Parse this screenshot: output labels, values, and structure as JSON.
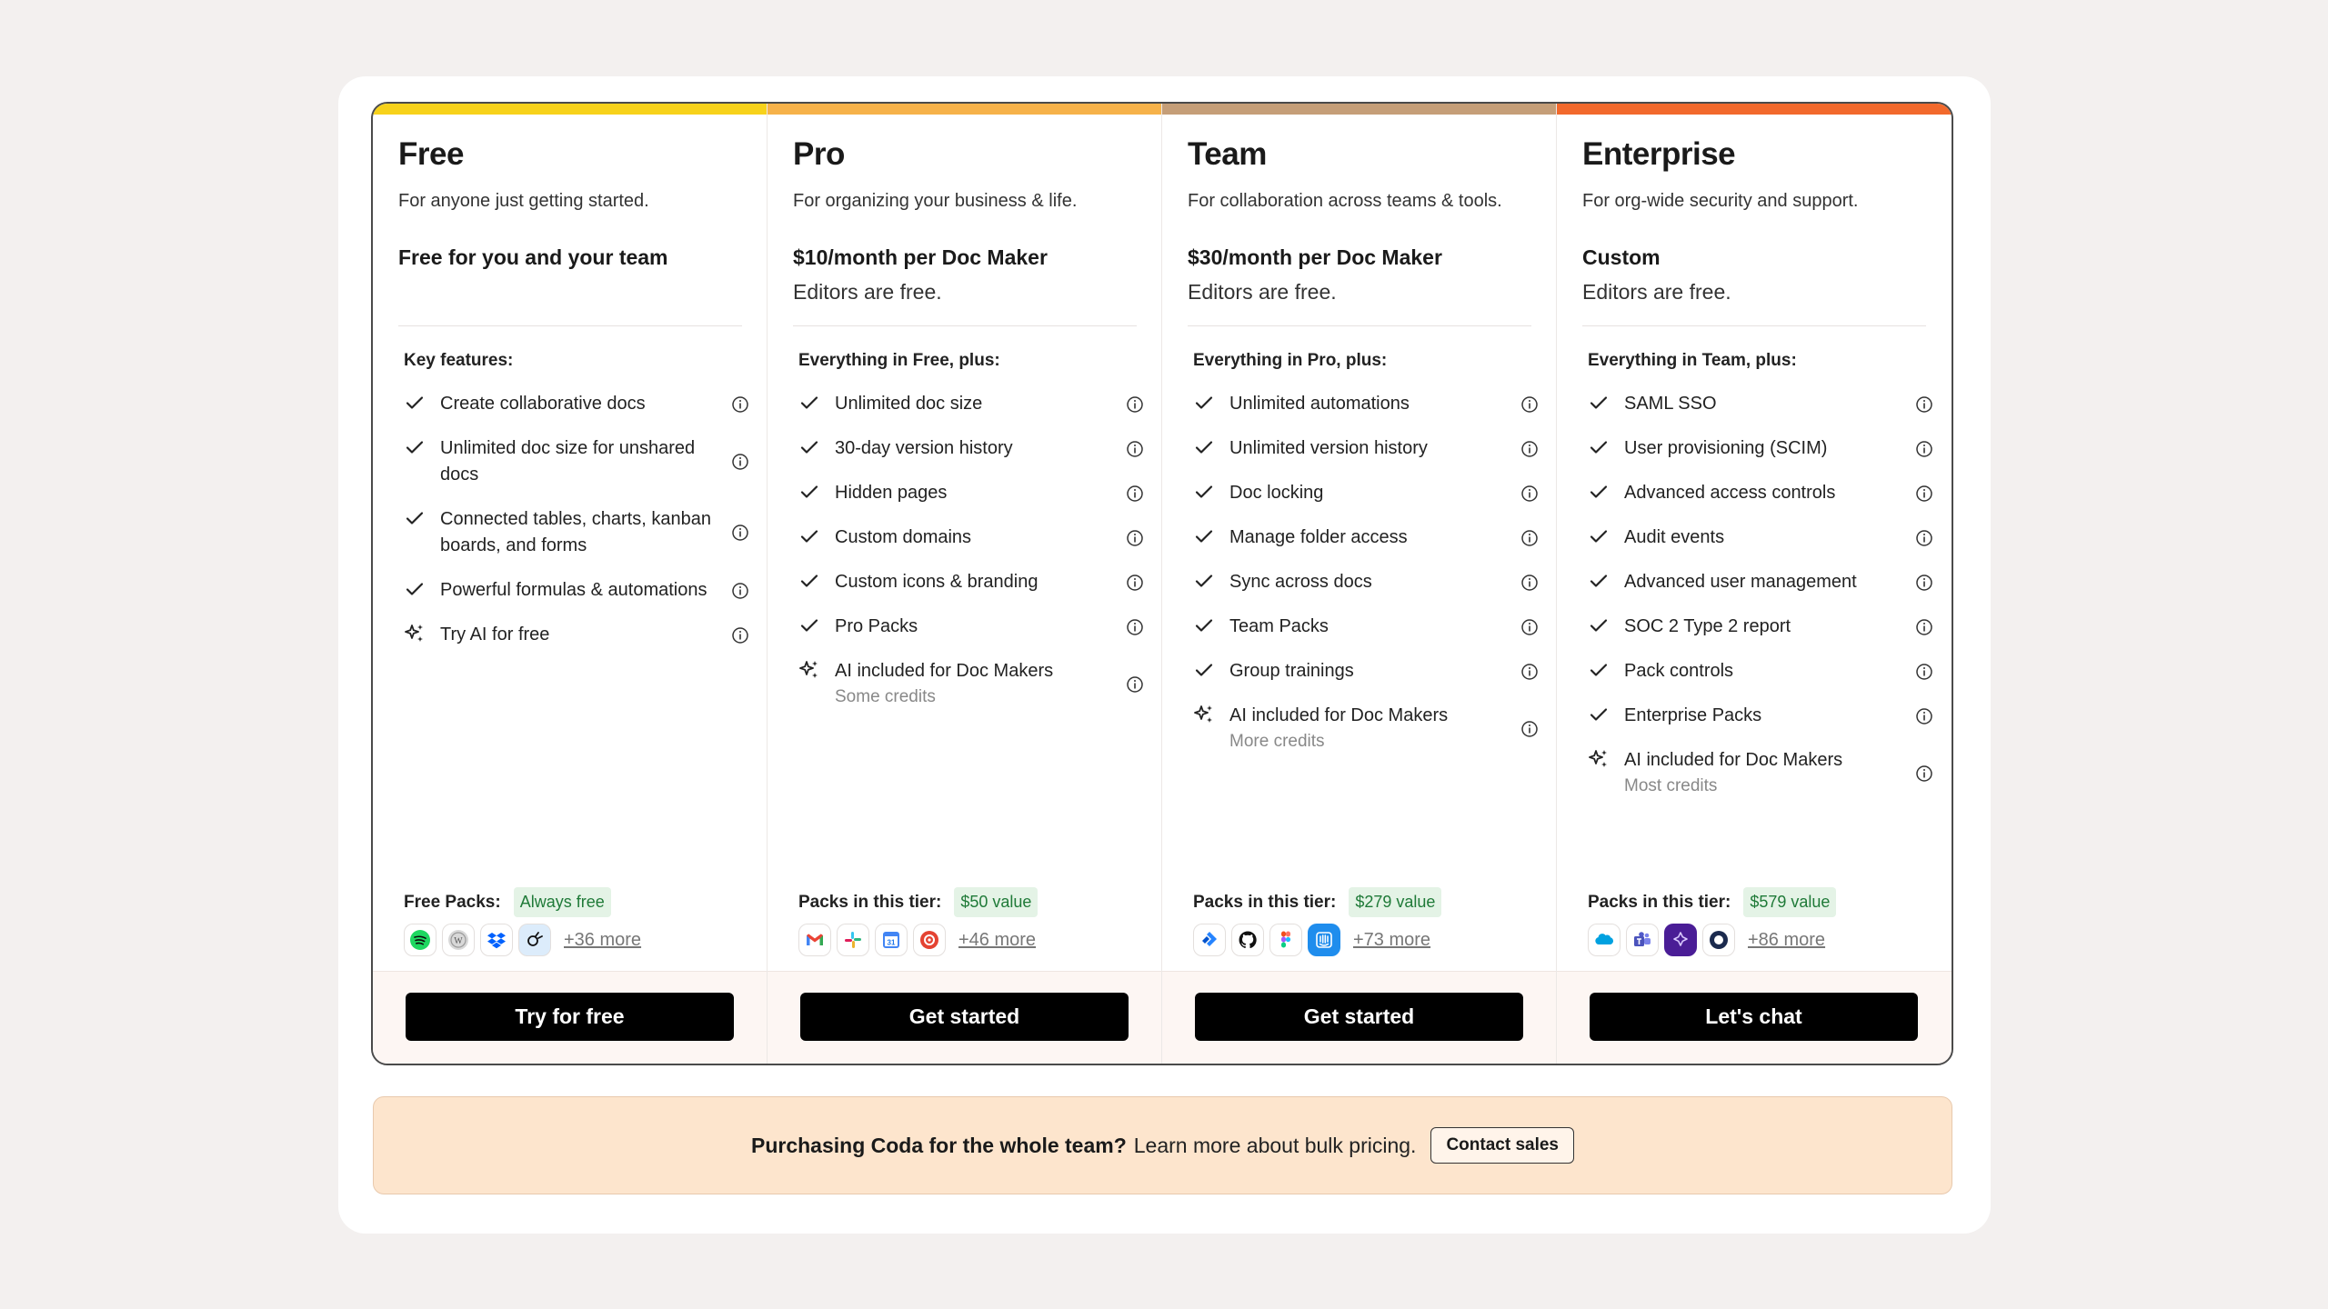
{
  "colors": {
    "free_bar": "#f7d21b",
    "pro_bar": "#f6b24a",
    "team_bar": "#c59e78",
    "enterprise_bar": "#f2692c",
    "button_bg": "#000000",
    "banner_bg": "#fde5cd"
  },
  "plans": [
    {
      "name": "Free",
      "description": "For anyone just getting started.",
      "price": "Free for you and your team",
      "editors": "",
      "features_heading": "Key features:",
      "features": [
        {
          "icon": "check-icon",
          "label": "Create collaborative docs",
          "sub": ""
        },
        {
          "icon": "check-icon",
          "label": "Unlimited doc size for unshared docs",
          "sub": ""
        },
        {
          "icon": "check-icon",
          "label": "Connected tables, charts, kanban boards, and forms",
          "sub": ""
        },
        {
          "icon": "check-icon",
          "label": "Powerful formulas & automations",
          "sub": ""
        },
        {
          "icon": "sparkle-icon",
          "label": "Try AI for free",
          "sub": ""
        }
      ],
      "packs_label": "Free Packs:",
      "packs_badge": "Always free",
      "pack_icons": [
        "spotify-icon",
        "wikipedia-icon",
        "dropbox-icon",
        "pack-icon"
      ],
      "more": "+36 more",
      "cta": "Try for free"
    },
    {
      "name": "Pro",
      "description": "For organizing your business & life.",
      "price": "$10/month per Doc Maker",
      "editors": "Editors are free.",
      "features_heading": "Everything in Free, plus:",
      "features": [
        {
          "icon": "check-icon",
          "label": "Unlimited doc size",
          "sub": ""
        },
        {
          "icon": "check-icon",
          "label": "30-day version history",
          "sub": ""
        },
        {
          "icon": "check-icon",
          "label": "Hidden pages",
          "sub": ""
        },
        {
          "icon": "check-icon",
          "label": "Custom domains",
          "sub": ""
        },
        {
          "icon": "check-icon",
          "label": "Custom icons & branding",
          "sub": ""
        },
        {
          "icon": "check-icon",
          "label": "Pro Packs",
          "sub": ""
        },
        {
          "icon": "sparkle-icon",
          "label": "AI included for Doc Makers",
          "sub": "Some credits"
        }
      ],
      "packs_label": "Packs in this tier:",
      "packs_badge": "$50 value",
      "pack_icons": [
        "gmail-icon",
        "slack-icon",
        "google-calendar-icon",
        "todoist-icon"
      ],
      "more": "+46 more",
      "cta": "Get started"
    },
    {
      "name": "Team",
      "description": "For collaboration across teams & tools.",
      "price": "$30/month per Doc Maker",
      "editors": "Editors are free.",
      "features_heading": "Everything in Pro, plus:",
      "features": [
        {
          "icon": "check-icon",
          "label": "Unlimited automations",
          "sub": ""
        },
        {
          "icon": "check-icon",
          "label": "Unlimited version history",
          "sub": ""
        },
        {
          "icon": "check-icon",
          "label": "Doc locking",
          "sub": ""
        },
        {
          "icon": "check-icon",
          "label": "Manage folder access",
          "sub": ""
        },
        {
          "icon": "check-icon",
          "label": "Sync across docs",
          "sub": ""
        },
        {
          "icon": "check-icon",
          "label": "Team Packs",
          "sub": ""
        },
        {
          "icon": "check-icon",
          "label": "Group trainings",
          "sub": ""
        },
        {
          "icon": "sparkle-icon",
          "label": "AI included for Doc Makers",
          "sub": "More credits"
        }
      ],
      "packs_label": "Packs in this tier:",
      "packs_badge": "$279 value",
      "pack_icons": [
        "jira-icon",
        "github-icon",
        "figma-icon",
        "intercom-icon"
      ],
      "more": "+73 more",
      "cta": "Get started"
    },
    {
      "name": "Enterprise",
      "description": "For org-wide security and support.",
      "price": "Custom",
      "editors": "Editors are free.",
      "features_heading": "Everything in Team, plus:",
      "features": [
        {
          "icon": "check-icon",
          "label": "SAML SSO",
          "sub": ""
        },
        {
          "icon": "check-icon",
          "label": "User provisioning (SCIM)",
          "sub": ""
        },
        {
          "icon": "check-icon",
          "label": "Advanced access controls",
          "sub": ""
        },
        {
          "icon": "check-icon",
          "label": "Audit events",
          "sub": ""
        },
        {
          "icon": "check-icon",
          "label": "Advanced user management",
          "sub": ""
        },
        {
          "icon": "check-icon",
          "label": "SOC 2 Type 2 report",
          "sub": ""
        },
        {
          "icon": "check-icon",
          "label": "Pack controls",
          "sub": ""
        },
        {
          "icon": "check-icon",
          "label": "Enterprise Packs",
          "sub": ""
        },
        {
          "icon": "sparkle-icon",
          "label": "AI included for Doc Makers",
          "sub": "Most credits"
        }
      ],
      "packs_label": "Packs in this tier:",
      "packs_badge": "$579 value",
      "pack_icons": [
        "salesforce-icon",
        "teams-icon",
        "pack-icon",
        "okta-icon"
      ],
      "more": "+86 more",
      "cta": "Let's chat"
    }
  ],
  "banner": {
    "bold": "Purchasing Coda for the whole team?",
    "text": "Learn more about bulk pricing.",
    "button": "Contact sales"
  }
}
